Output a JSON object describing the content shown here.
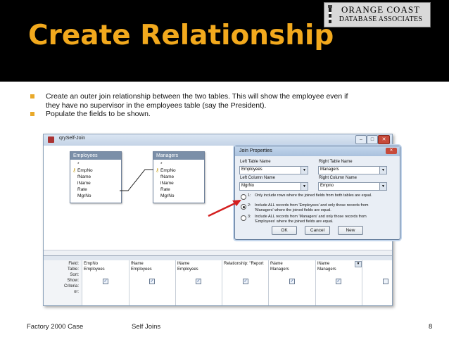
{
  "slide": {
    "title": "Create Relationship",
    "logo": {
      "line1": "ORANGE COAST",
      "line2": "DATABASE ASSOCIATES"
    },
    "bullets": [
      {
        "line1": "Create an outer join relationship between the two tables. This will show the employee even if",
        "line2": "they have no supervisor in the employees  table (say the President)."
      },
      {
        "line1": "Populate the fields to be shown.",
        "line2": ""
      }
    ],
    "footer": {
      "left": "Factory 2000 Case",
      "center": "Self Joins",
      "page": "8"
    }
  },
  "window": {
    "title": "qrySelf-Join",
    "buttons": {
      "min": "–",
      "max": "□",
      "close": "✕"
    },
    "tables": [
      {
        "name": "Employees",
        "fields": [
          "*",
          "EmpNo",
          "fName",
          "lName",
          "Rate",
          "MgrNo"
        ]
      },
      {
        "name": "Managers",
        "fields": [
          "*",
          "EmpNo",
          "fName",
          "lName",
          "Rate",
          "MgrNo"
        ]
      }
    ],
    "grid": {
      "row_labels": [
        "Field:",
        "Table:",
        "Sort:",
        "Show:",
        "Criteria:",
        "or:"
      ],
      "columns": [
        {
          "field": "EmpNo",
          "table": "Employees",
          "show": true
        },
        {
          "field": "fName",
          "table": "Employees",
          "show": true
        },
        {
          "field": "lName",
          "table": "Employees",
          "show": true
        },
        {
          "field": "Relationship: \"Report",
          "table": "",
          "show": true
        },
        {
          "field": "fName",
          "table": "Managers",
          "show": true
        },
        {
          "field": "lName",
          "table": "Managers",
          "show": true
        },
        {
          "field": "",
          "table": "",
          "show": false
        }
      ]
    }
  },
  "dialog": {
    "title": "Join Properties",
    "close": "✕",
    "left_table_label": "Left Table Name",
    "right_table_label": "Right Table Name",
    "left_table_value": "Employees",
    "right_table_value": "Managers",
    "left_column_label": "Left Column Name",
    "right_column_label": "Right Column Name",
    "left_column_value": "MgrNo",
    "right_column_value": "Empno",
    "options": [
      {
        "num": "1:",
        "line1": "Only include rows where the joined fields from both tables are equal.",
        "line2": "",
        "selected": false
      },
      {
        "num": "2:",
        "line1": "Include ALL records from 'Employees' and only those records from",
        "line2": "'Managers' where the joined fields are equal.",
        "selected": true
      },
      {
        "num": "3:",
        "line1": "Include ALL records from 'Managers' and only those records from",
        "line2": "'Employees' where the joined fields are equal.",
        "selected": false
      }
    ],
    "buttons": {
      "ok": "OK",
      "cancel": "Cancel",
      "new": "New"
    }
  },
  "colors": {
    "title": "#f2a91d",
    "bullet": "#e9a92a",
    "arrow": "#d41f1f"
  }
}
